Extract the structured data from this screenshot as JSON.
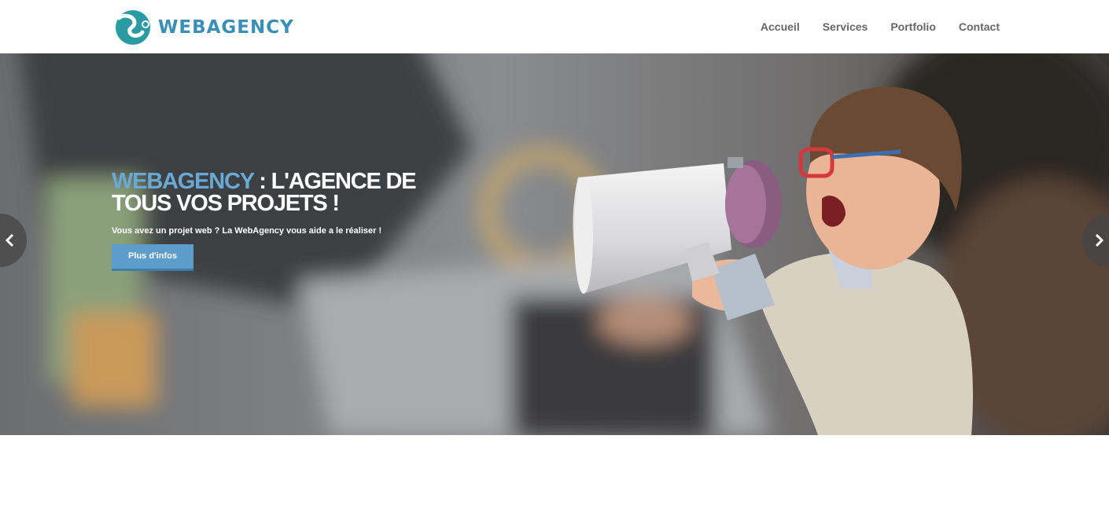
{
  "brand": {
    "name": "WEBAGENCY",
    "color": "#3a8fb7",
    "logo_icon": "swirl-logo-icon"
  },
  "nav": {
    "items": [
      {
        "label": "Accueil"
      },
      {
        "label": "Services"
      },
      {
        "label": "Portfolio"
      },
      {
        "label": "Contact"
      }
    ]
  },
  "hero": {
    "title_brand": "WEBAGENCY",
    "title_rest": " : L'AGENCE DE TOUS VOS PROJETS !",
    "subtitle": "Vous avez un projet web ? La WebAgency vous aide a le réaliser !",
    "button_label": "Plus d'infos",
    "accent_color": "#6aa9d4",
    "button_color": "#5d9dcb",
    "prev_icon": "chevron-left-icon",
    "next_icon": "chevron-right-icon"
  }
}
